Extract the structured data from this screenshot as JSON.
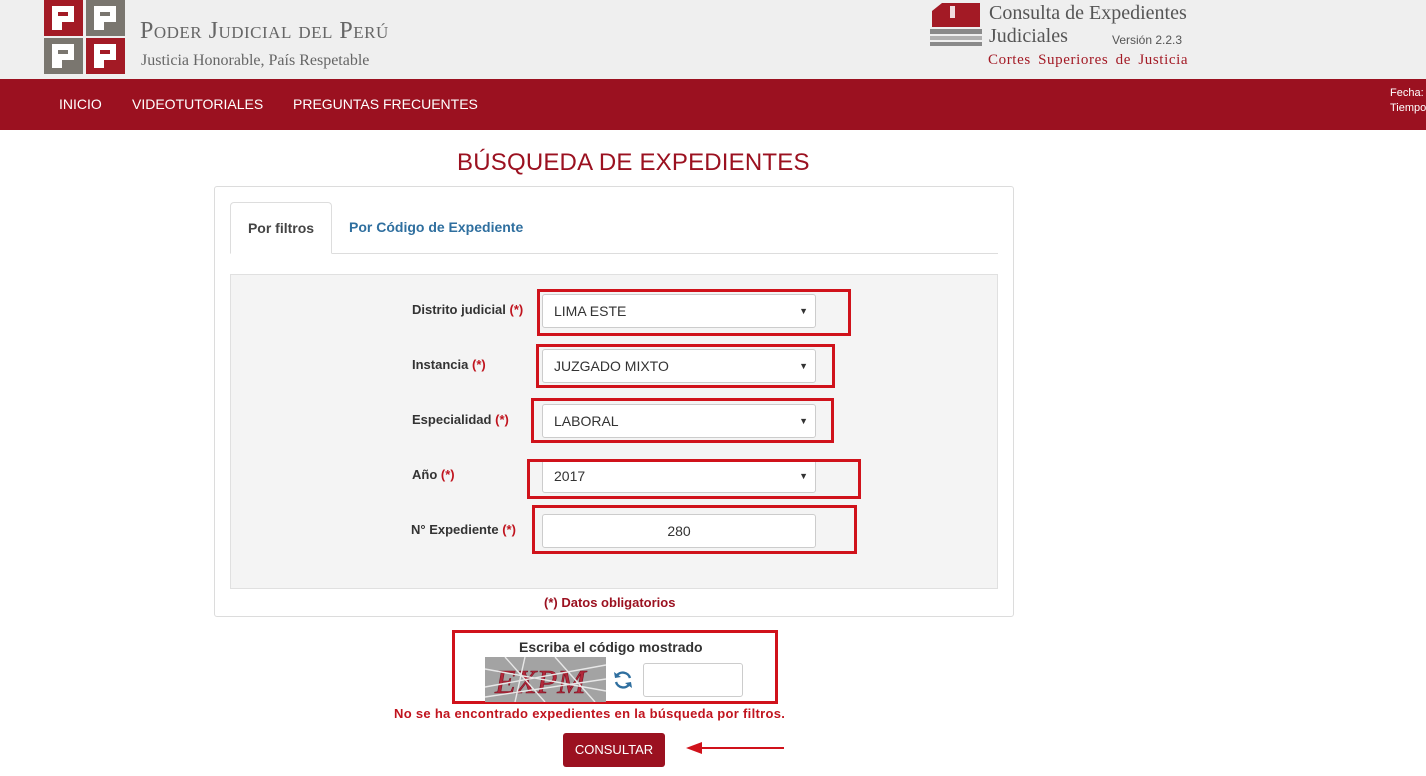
{
  "header": {
    "org_name": "Poder Judicial del Perú",
    "org_motto": "Justicia Honorable, País Respetable",
    "app_title_line1": "Consulta de Expedientes",
    "app_title_line2": "Judiciales",
    "app_version": "Versión 2.2.3",
    "app_subtitle": "Cortes Superiores de Justicia"
  },
  "nav": {
    "items": [
      "INICIO",
      "VIDEOTUTORIALES",
      "PREGUNTAS FRECUENTES"
    ],
    "fecha_label": "Fecha:",
    "tiempo_label": "Tiempo"
  },
  "page": {
    "title": "BÚSQUEDA DE EXPEDIENTES"
  },
  "tabs": {
    "active": "Por filtros",
    "inactive": "Por Código de Expediente"
  },
  "form": {
    "required_marker": "(*)",
    "distrito": {
      "label": "Distrito judicial",
      "value": "LIMA ESTE"
    },
    "instancia": {
      "label": "Instancia",
      "value": "JUZGADO MIXTO"
    },
    "especialidad": {
      "label": "Especialidad",
      "value": "LABORAL"
    },
    "anio": {
      "label": "Año",
      "value": "2017"
    },
    "expediente": {
      "label": "N° Expediente",
      "value": "280"
    },
    "required_note": "(*) Datos obligatorios"
  },
  "captcha": {
    "label": "Escriba el código mostrado",
    "code": "EXPM",
    "input_value": ""
  },
  "error_message": "No se ha encontrado expedientes en la búsqueda por filtros.",
  "submit_label": "CONSULTAR",
  "colors": {
    "brand": "#9b1120",
    "highlight": "#d0121b",
    "link": "#2f6f9f"
  }
}
